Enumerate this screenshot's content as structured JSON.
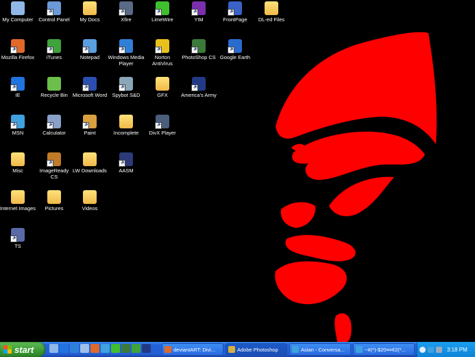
{
  "desktop": {
    "icons": [
      {
        "label": "My Computer",
        "icon": "computer-icon",
        "color": "#8fb7e8"
      },
      {
        "label": "Control Panel",
        "icon": "control-panel-icon",
        "color": "#6a9ad8"
      },
      {
        "label": "My Docs",
        "icon": "documents-folder-icon",
        "color": "#f3cf62"
      },
      {
        "label": "Xfire",
        "icon": "xfire-icon",
        "color": "#5a6a88"
      },
      {
        "label": "LimeWire",
        "icon": "limewire-icon",
        "color": "#3fbf2e"
      },
      {
        "label": "YIM",
        "icon": "yahoo-messenger-icon",
        "color": "#7b2fae"
      },
      {
        "label": "FrontPage",
        "icon": "frontpage-icon",
        "color": "#3a62c8"
      },
      {
        "label": "DL-ed Files",
        "icon": "folder-icon",
        "color": "#f3cf62"
      },
      {
        "label": "Mozilla Firefox",
        "icon": "firefox-icon",
        "color": "#e0692a"
      },
      {
        "label": "iTunes",
        "icon": "itunes-icon",
        "color": "#3ea33a"
      },
      {
        "label": "Notepad",
        "icon": "notepad-icon",
        "color": "#5a9fe0"
      },
      {
        "label": "Windows Media Player",
        "icon": "media-player-icon",
        "color": "#2f7fd8"
      },
      {
        "label": "Norton AntiVirus",
        "icon": "norton-icon",
        "color": "#e9c11d"
      },
      {
        "label": "PhotoShop CS",
        "icon": "photoshop-icon",
        "color": "#3b7a3a"
      },
      {
        "label": "Google Earth",
        "icon": "google-earth-icon",
        "color": "#2a6bd0"
      },
      {
        "label": "IE",
        "icon": "internet-explorer-icon",
        "color": "#1f74e0"
      },
      {
        "label": "Recycle Bin",
        "icon": "recycle-bin-icon",
        "color": "#6cbf4a"
      },
      {
        "label": "Microsoft Word",
        "icon": "word-icon",
        "color": "#2a4fb0"
      },
      {
        "label": "Spybot S&D",
        "icon": "spybot-icon",
        "color": "#8aa6b8"
      },
      {
        "label": "GFX",
        "icon": "folder-icon",
        "color": "#f3cf62"
      },
      {
        "label": "America's Army",
        "icon": "americas-army-icon",
        "color": "#223a86"
      },
      {
        "label": "MSN",
        "icon": "msn-icon",
        "color": "#3fa1e0"
      },
      {
        "label": "Calculator",
        "icon": "calculator-icon",
        "color": "#8aa0c8"
      },
      {
        "label": "Paint",
        "icon": "paint-icon",
        "color": "#d8a040"
      },
      {
        "label": "Incomplete",
        "icon": "folder-icon",
        "color": "#f3cf62"
      },
      {
        "label": "DivX Player",
        "icon": "divx-icon",
        "color": "#4a5e7a"
      },
      {
        "label": "Misc",
        "icon": "folder-icon",
        "color": "#f3cf62"
      },
      {
        "label": "ImageReady CS",
        "icon": "imageready-icon",
        "color": "#c07a28"
      },
      {
        "label": "LW Downloads",
        "icon": "folder-icon",
        "color": "#f3cf62"
      },
      {
        "label": "AASM",
        "icon": "aasm-icon",
        "color": "#2c3a7a"
      },
      {
        "label": "Internet Images",
        "icon": "folder-icon",
        "color": "#f3cf62"
      },
      {
        "label": "Pictures",
        "icon": "folder-icon",
        "color": "#f3cf62"
      },
      {
        "label": "Videos",
        "icon": "folder-icon",
        "color": "#f3cf62"
      },
      {
        "label": "TS",
        "icon": "teamspeak-icon",
        "color": "#5a6aa8"
      }
    ]
  },
  "wallpaper": {
    "color": "#ff0000",
    "background": "#000000"
  },
  "taskbar": {
    "start_label": "start",
    "tasks": [
      {
        "label": "deviantART: Divi...",
        "icon": "firefox-icon",
        "color": "#e0692a"
      },
      {
        "label": "Adobe Photoshop",
        "icon": "photoshop-icon",
        "color": "#d8b040"
      },
      {
        "label": "Asian - Conversa...",
        "icon": "msn-icon",
        "color": "#3fa1e0"
      },
      {
        "label": "~#(*)-$20¤¤¢2(*...",
        "icon": "msn-icon",
        "color": "#3fa1e0"
      }
    ],
    "clock": "3:18 PM"
  }
}
